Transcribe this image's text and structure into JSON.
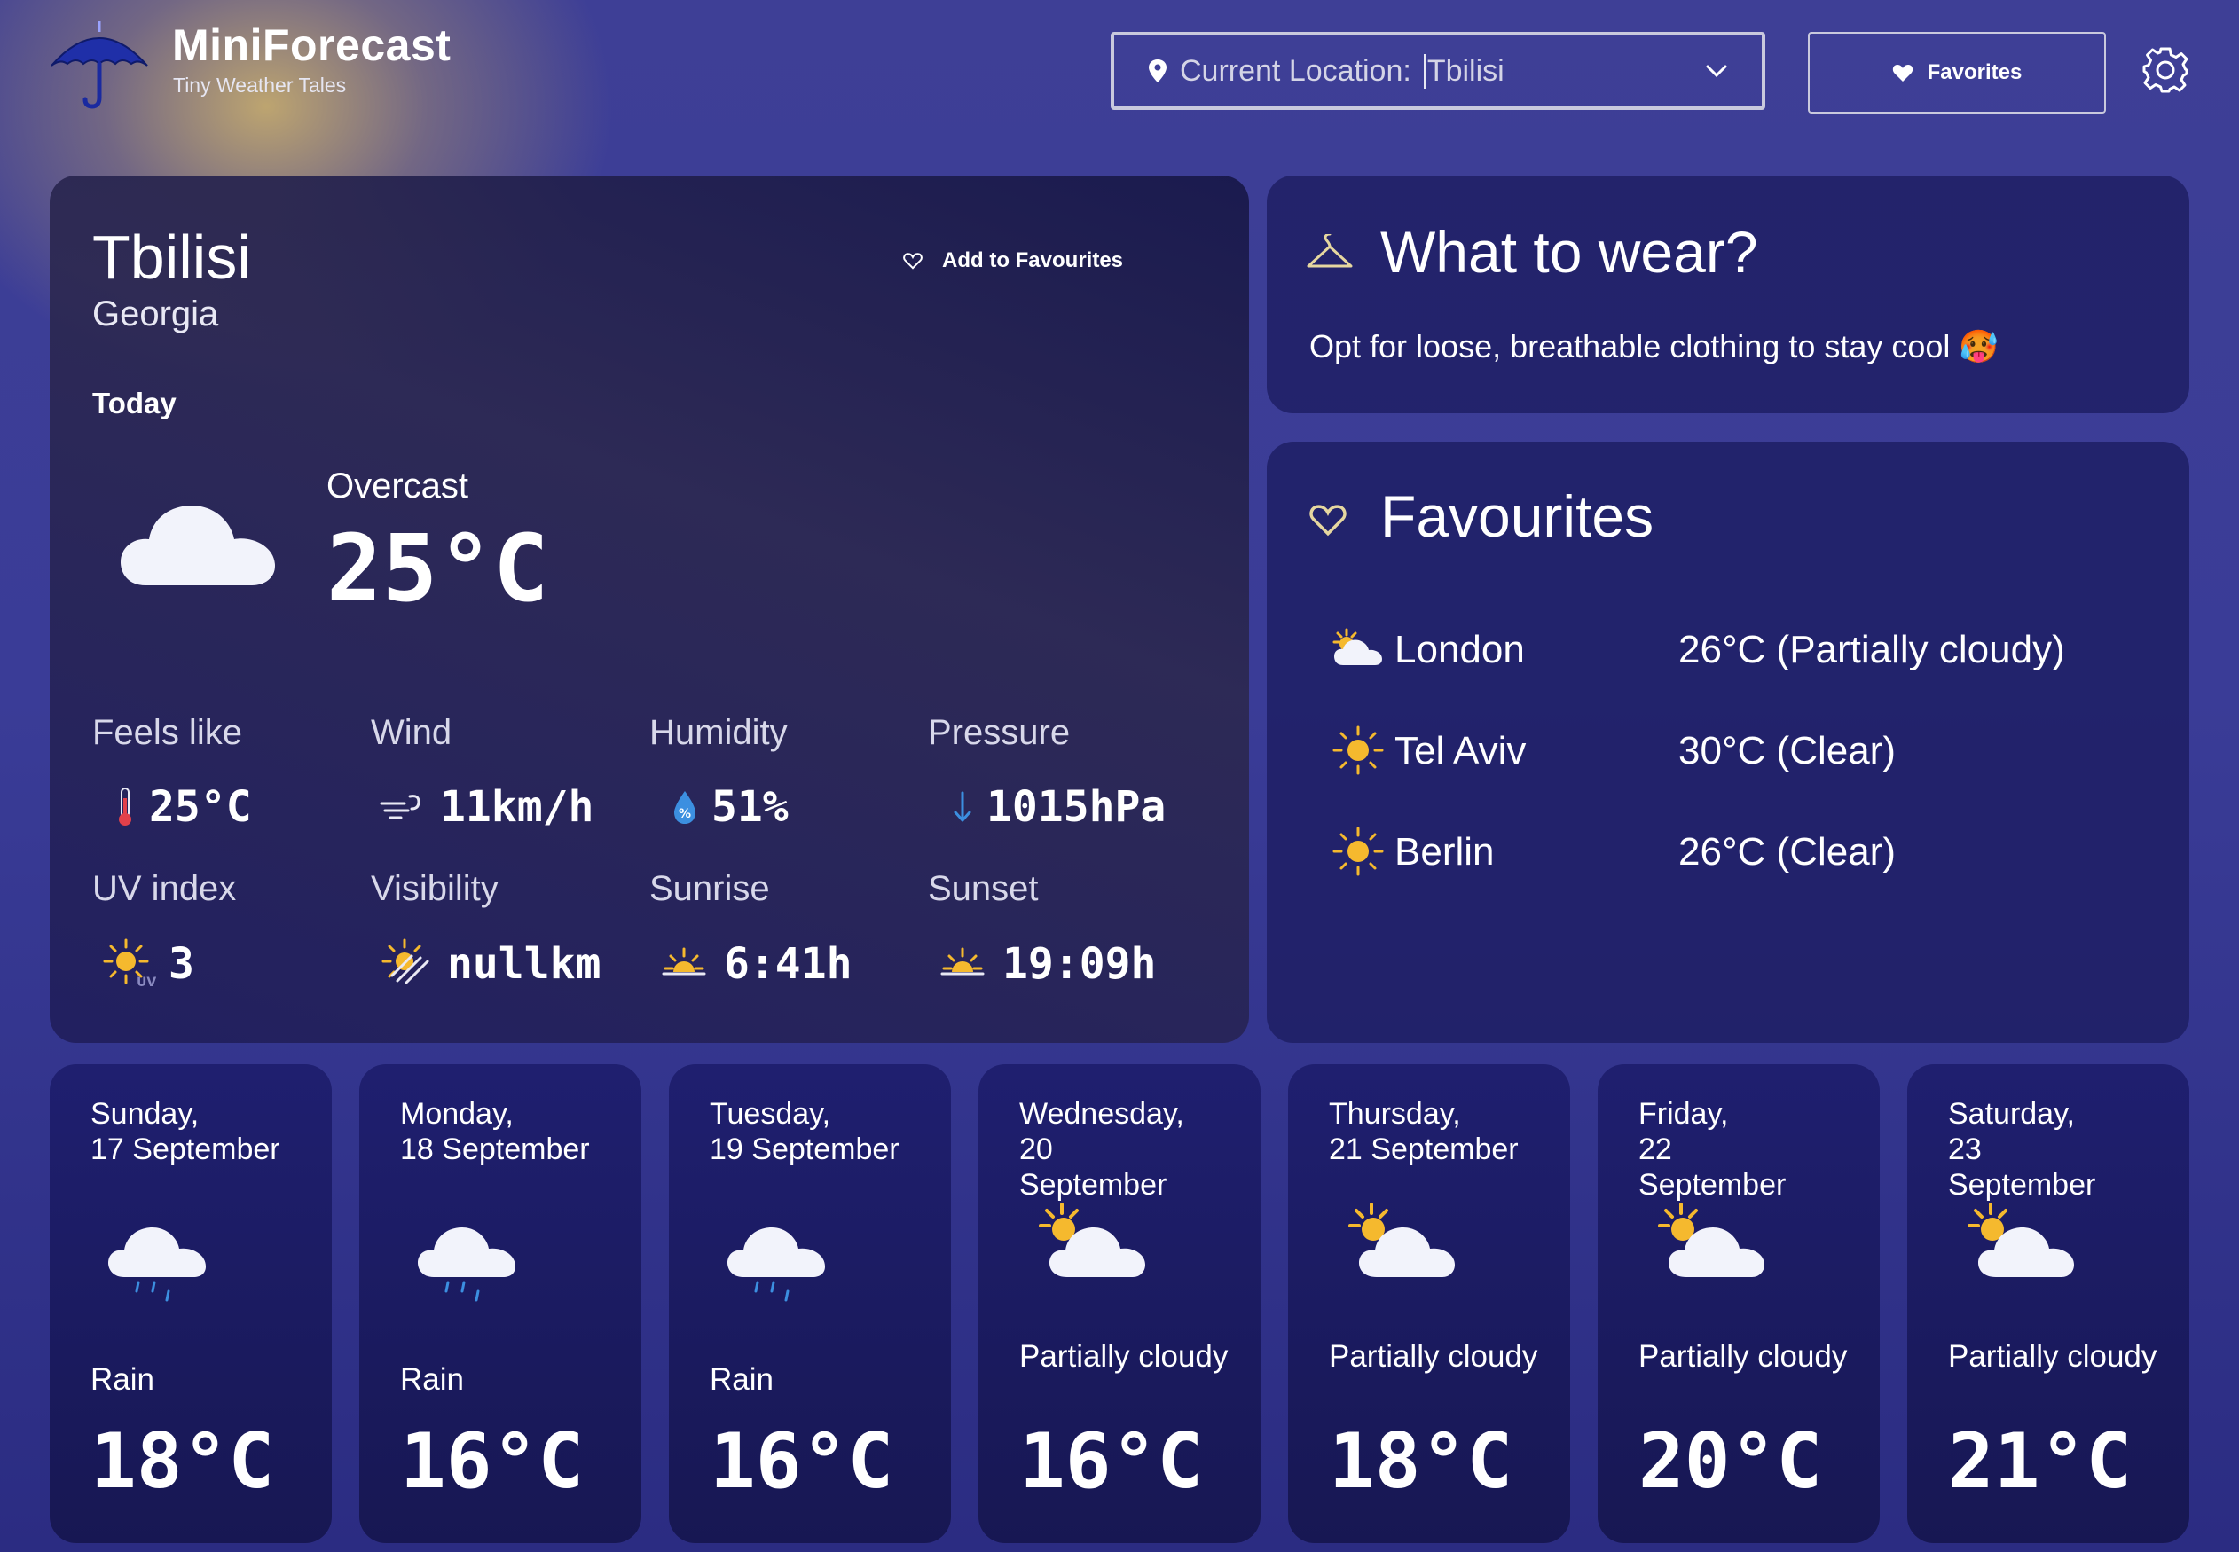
{
  "app": {
    "title": "MiniForecast",
    "subtitle": "Tiny Weather Tales"
  },
  "header": {
    "location_label": "Current Location:",
    "location_value": "Tbilisi",
    "favorites_button": "Favorites"
  },
  "current": {
    "city": "Tbilisi",
    "country": "Georgia",
    "add_to_favourites": "Add to Favourites",
    "today_label": "Today",
    "condition": "Overcast",
    "temperature": "25°C",
    "stats": [
      {
        "label": "Feels like",
        "value": "25°C",
        "icon": "thermometer-icon"
      },
      {
        "label": "Wind",
        "value": "11km/h",
        "icon": "wind-icon"
      },
      {
        "label": "Humidity",
        "value": "51%",
        "icon": "humidity-icon"
      },
      {
        "label": "Pressure",
        "value": "1015hPa",
        "icon": "arrow-down-icon"
      },
      {
        "label": "UV index",
        "value": "3",
        "icon": "uv-sun-icon"
      },
      {
        "label": "Visibility",
        "value": "nullkm",
        "icon": "hazy-sun-icon"
      },
      {
        "label": "Sunrise",
        "value": "6:41h",
        "icon": "sunrise-icon"
      },
      {
        "label": "Sunset",
        "value": "19:09h",
        "icon": "sunset-icon"
      }
    ]
  },
  "wear": {
    "title": "What to wear?",
    "text": "Opt for loose, breathable clothing to stay cool 🥵"
  },
  "favourites": {
    "title": "Favourites",
    "items": [
      {
        "city": "London",
        "weather": "26°C (Partially cloudy)",
        "icon": "partly-cloudy-icon"
      },
      {
        "city": "Tel Aviv",
        "weather": "30°C (Clear)",
        "icon": "sun-icon"
      },
      {
        "city": "Berlin",
        "weather": "26°C (Clear)",
        "icon": "sun-icon"
      }
    ]
  },
  "forecast": [
    {
      "day": "Sunday,",
      "date": "17 September",
      "condition": "Rain",
      "temp": "18°C",
      "icon": "rain-cloud-icon"
    },
    {
      "day": "Monday,",
      "date": "18 September",
      "condition": "Rain",
      "temp": "16°C",
      "icon": "rain-cloud-icon"
    },
    {
      "day": "Tuesday,",
      "date": "19 September",
      "condition": "Rain",
      "temp": "16°C",
      "icon": "rain-cloud-icon"
    },
    {
      "day": "Wednesday,",
      "date": "20 September",
      "condition": "Partially cloudy",
      "temp": "16°C",
      "icon": "partly-cloudy-icon"
    },
    {
      "day": "Thursday,",
      "date": "21 September",
      "condition": "Partially cloudy",
      "temp": "18°C",
      "icon": "partly-cloudy-icon"
    },
    {
      "day": "Friday,",
      "date": "22 September",
      "condition": "Partially cloudy",
      "temp": "20°C",
      "icon": "partly-cloudy-icon"
    },
    {
      "day": "Saturday,",
      "date": "23 September",
      "condition": "Partially cloudy",
      "temp": "21°C",
      "icon": "partly-cloudy-icon"
    }
  ],
  "colors": {
    "sun": "#f5b92e",
    "accent": "#2a2b8f",
    "cloud": "#f2f3fb"
  }
}
